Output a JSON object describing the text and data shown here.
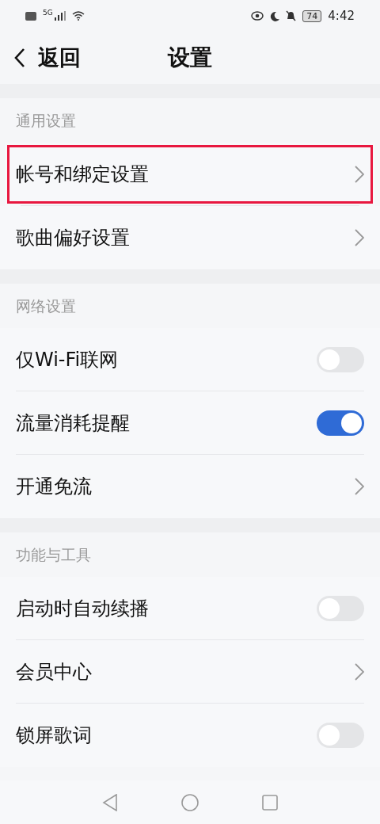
{
  "status_bar": {
    "time": "4:42",
    "battery": "74",
    "network": "5G"
  },
  "header": {
    "back": "返回",
    "title": "设置"
  },
  "sections": [
    {
      "title": "通用设置",
      "items": [
        {
          "kind": "link",
          "label": "帐号和绑定设置",
          "highlighted": true
        },
        {
          "kind": "link",
          "label": "歌曲偏好设置",
          "highlighted": false
        }
      ]
    },
    {
      "title": "网络设置",
      "items": [
        {
          "kind": "toggle",
          "label": "仅Wi-Fi联网",
          "on": false,
          "highlighted": false
        },
        {
          "kind": "toggle",
          "label": "流量消耗提醒",
          "on": true,
          "highlighted": false
        },
        {
          "kind": "link",
          "label": "开通免流",
          "highlighted": false
        }
      ]
    },
    {
      "title": "功能与工具",
      "items": [
        {
          "kind": "toggle",
          "label": "启动时自动续播",
          "on": false,
          "highlighted": false
        },
        {
          "kind": "link",
          "label": "会员中心",
          "highlighted": false
        },
        {
          "kind": "toggle",
          "label": "锁屏歌词",
          "on": false,
          "highlighted": false
        }
      ]
    }
  ]
}
